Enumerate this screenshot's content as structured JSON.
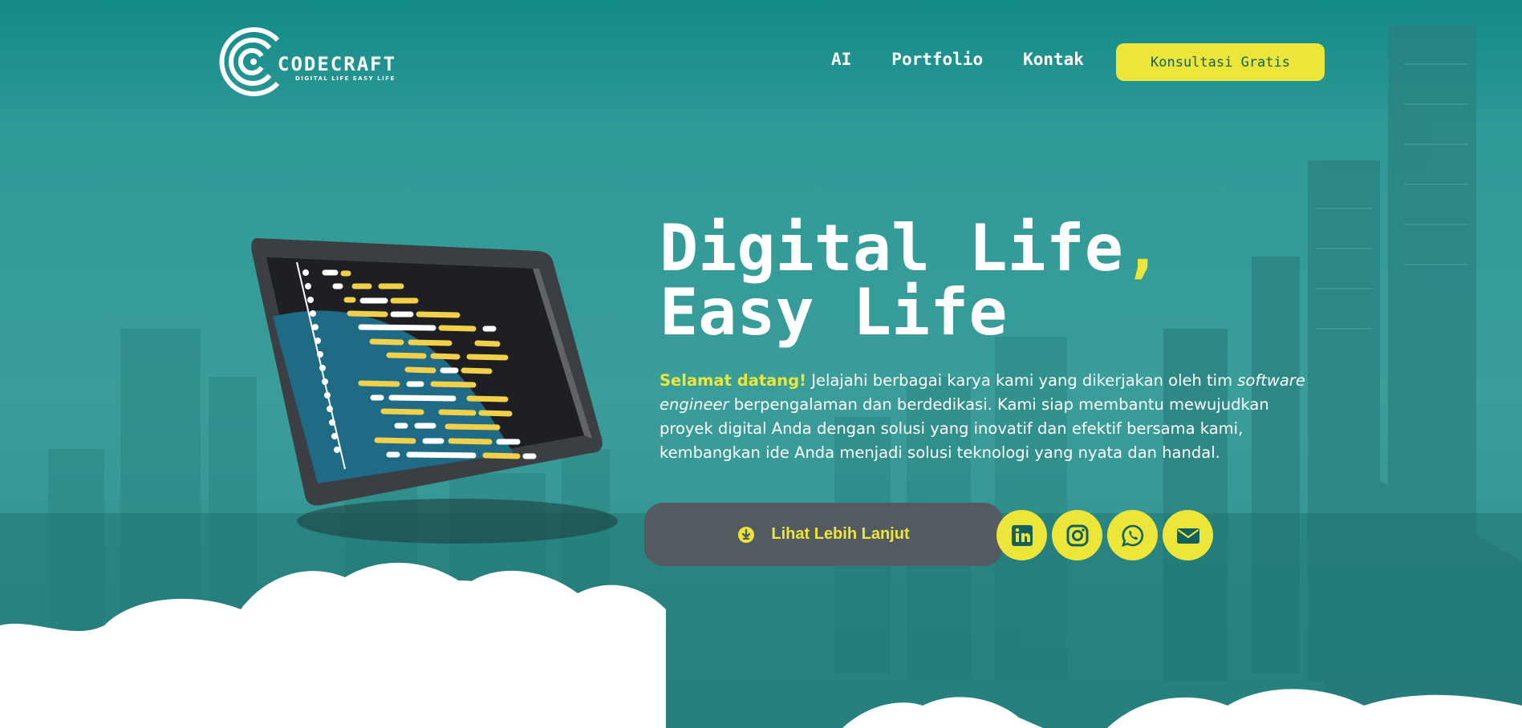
{
  "brand": {
    "name": "CODECRAFT",
    "tagline": "DIGITAL LIFE EASY LIFE"
  },
  "nav": {
    "items": [
      "AI",
      "Portfolio",
      "Kontak"
    ],
    "cta": "Konsultasi Gratis"
  },
  "hero": {
    "title_line1": "Digital Life",
    "title_comma": ",",
    "title_line2": "Easy Life",
    "intro_highlight": "Selamat datang!",
    "intro_part1": " Jelajahi berbagai karya kami yang dikerjakan oleh tim ",
    "intro_italic": "software engineer",
    "intro_part2": " berpengalaman dan berdedikasi. Kami siap membantu mewujudkan proyek digital Anda dengan solusi yang inovatif dan efektif bersama kami, kembangkan ide Anda menjadi solusi teknologi yang nyata dan handal.",
    "more_button": "Lihat Lebih Lanjut"
  },
  "socials": [
    {
      "icon": "linkedin-icon"
    },
    {
      "icon": "instagram-icon"
    },
    {
      "icon": "whatsapp-icon"
    },
    {
      "icon": "mail-icon"
    }
  ],
  "colors": {
    "accent": "#ede63a",
    "teal": "#2f9a97",
    "dark_button": "#535a61",
    "icon_teal": "#12615f"
  }
}
